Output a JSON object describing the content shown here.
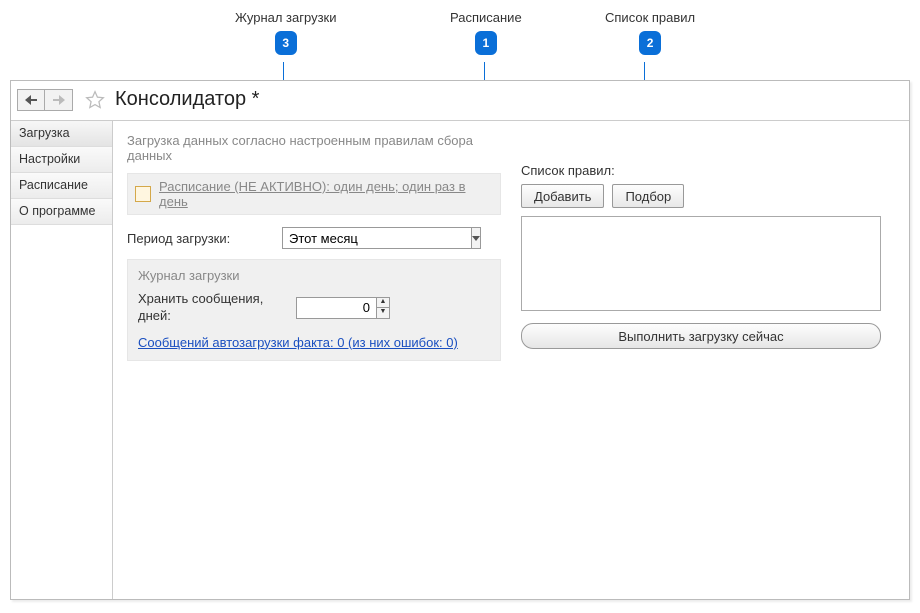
{
  "callouts": {
    "log": {
      "label": "Журнал загрузки",
      "num": "3"
    },
    "sched": {
      "label": "Расписание",
      "num": "1"
    },
    "rules": {
      "label": "Список правил",
      "num": "2"
    }
  },
  "window": {
    "title": "Консолидатор *"
  },
  "sidebar": {
    "items": [
      {
        "label": "Загрузка"
      },
      {
        "label": "Настройки"
      },
      {
        "label": "Расписание"
      },
      {
        "label": "О программе"
      }
    ]
  },
  "main": {
    "desc": "Загрузка данных согласно настроенным правилам сбора данных",
    "schedule_link": "Расписание (НЕ АКТИВНО): один день; один раз в день",
    "period_label": "Период загрузки:",
    "period_value": "Этот месяц",
    "log": {
      "title": "Журнал загрузки",
      "keep_label": "Хранить сообщения, дней:",
      "keep_value": "0",
      "msg_link": "Сообщений автозагрузки факта: 0 (из них ошибок: 0)"
    }
  },
  "right": {
    "rules_label": "Список правил:",
    "add_btn": "Добавить",
    "pick_btn": "Подбор",
    "run_btn": "Выполнить загрузку сейчас"
  }
}
